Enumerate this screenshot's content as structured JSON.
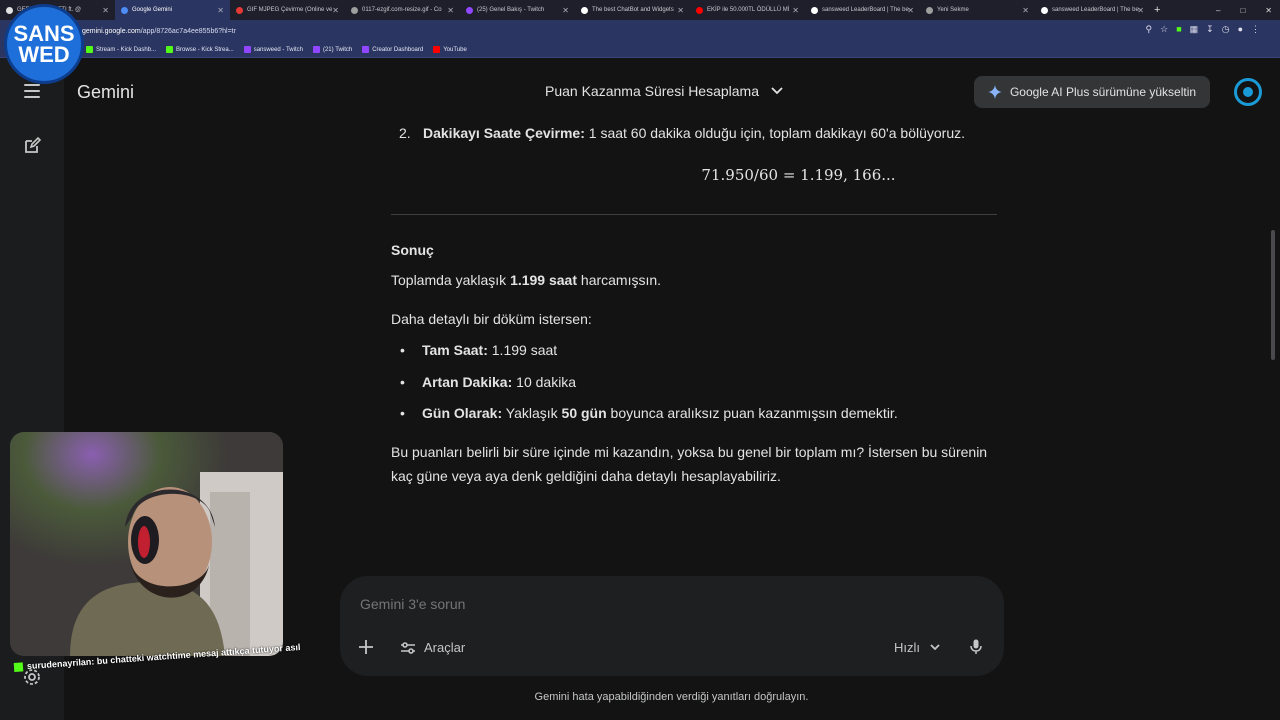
{
  "browser": {
    "tabs": [
      {
        "title": "GERÇEK PİLOTTI ft. @",
        "fav": "#e2e2e2",
        "active": false
      },
      {
        "title": "Google Gemini",
        "fav": "#4e8cf6",
        "active": true
      },
      {
        "title": "GIF MJPEG Çevirme (Online ve",
        "fav": "#e53935",
        "active": false
      },
      {
        "title": "0117-ezgif.com-resize.gif - Co",
        "fav": "#9e9e9e",
        "active": false
      },
      {
        "title": "(25) Genel Bakış - Twitch",
        "fav": "#9146ff",
        "active": false
      },
      {
        "title": "The best ChatBot and Widgets",
        "fav": "#ffffff",
        "active": false
      },
      {
        "title": "EKİP ile 50.000TL ÖDÜLLÜ Mİ",
        "fav": "#ff0000",
        "active": false
      },
      {
        "title": "sansweed LeaderBoard | The be",
        "fav": "#ffffff",
        "active": false
      },
      {
        "title": "Yeni Sekme",
        "fav": "#9e9e9e",
        "active": false
      },
      {
        "title": "sansweed LeaderBoard | The be",
        "fav": "#ffffff",
        "active": false
      }
    ],
    "url_host": "gemini.google.com",
    "url_path": "/app/8726ac7a4ee855b6?hl=tr",
    "bookmarks": [
      {
        "label": "Stream - Kick Dashb...",
        "color": "#53fc18"
      },
      {
        "label": "Browse - Kick Strea...",
        "color": "#53fc18"
      },
      {
        "label": "sansweed - Twitch",
        "color": "#9146ff"
      },
      {
        "label": "(21) Twitch",
        "color": "#9146ff"
      },
      {
        "label": "Creator Dashboard",
        "color": "#9146ff"
      },
      {
        "label": "YouTube",
        "color": "#ff0000"
      }
    ]
  },
  "channel_logo": {
    "line1": "SANS",
    "line2": "WED"
  },
  "header": {
    "app_title": "Gemini",
    "conversation_title": "Puan Kazanma Süresi Hesaplama",
    "upgrade_label": "Google AI Plus sürümüne yükseltin"
  },
  "response": {
    "step_number": "2.",
    "step_bold": "Dakikayı Saate Çevirme:",
    "step_text": " 1 saat 60 dakika olduğu için, toplam dakikayı 60'a bölüyoruz.",
    "formula": "71.950/60 = 1.199, 166...",
    "result_heading": "Sonuç",
    "result_prefix": "Toplamda yaklaşık ",
    "result_bold": "1.199 saat",
    "result_suffix": " harcamışsın.",
    "detail_intro": "Daha detaylı bir döküm istersen:",
    "bullets": [
      {
        "bold": "Tam Saat:",
        "text": " 1.199 saat"
      },
      {
        "bold": "Artan Dakika:",
        "text": " 10 dakika"
      },
      {
        "bold": "Gün Olarak:",
        "text": " Yaklaşık ",
        "bold2": "50 gün",
        "text2": " boyunca aralıksız puan kazanmışsın demektir."
      }
    ],
    "closing": "Bu puanları belirli bir süre içinde mi kazandın, yoksa bu genel bir toplam mı? İstersen bu sürenin kaç güne veya aya denk geldiğini daha detaylı hesaplayabiliriz."
  },
  "prompt": {
    "placeholder": "Gemini 3'e sorun",
    "tools_label": "Araçlar",
    "mode_label": "Hızlı"
  },
  "disclaimer": "Gemini hata yapabildiğinden verdiği yanıtları doğrulayın.",
  "stream_overlay": {
    "chat_user": "surudenayrilan",
    "chat_message": ": bu chatteki watchtime mesaj attıkça tutuyor asıl"
  }
}
